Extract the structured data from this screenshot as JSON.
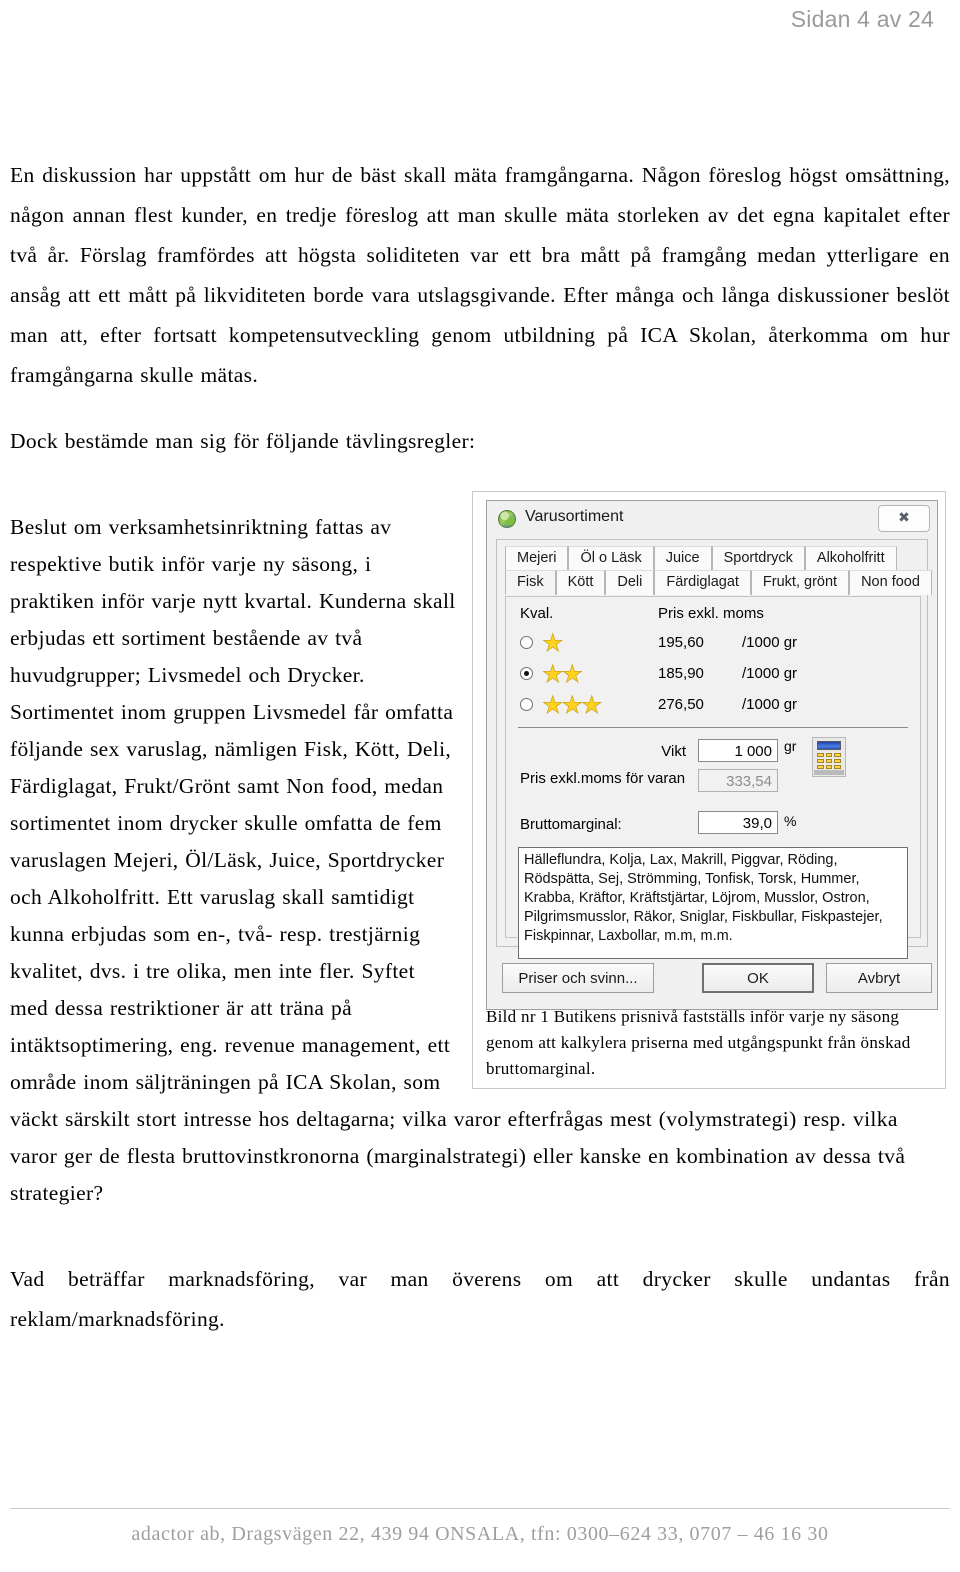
{
  "header": {
    "page_indicator": "Sidan 4 av 24"
  },
  "body": {
    "para1": "En diskussion har uppstått om hur de bäst skall mäta framgångarna. Någon föreslog högst omsättning, någon annan flest kunder, en tredje föreslog att man skulle mäta storleken av det egna kapitalet efter två år. Förslag framfördes att högsta soliditeten var ett bra mått på framgång medan ytterligare en ansåg att ett mått på likviditeten borde vara utslagsgivande. Efter många och långa diskussioner beslöt man att, efter fortsatt kompetensutveckling genom utbildning på ICA Skolan, återkomma om hur framgångarna skulle mätas.",
    "para2": "Dock bestämde man sig för följande tävlingsregler:",
    "para3": "Beslut om verksamhetsinriktning fattas av respektive butik inför varje ny säsong, i praktiken inför varje nytt kvartal. Kunderna skall erbjudas ett sortiment bestående av två huvudgrupper; Livsmedel och Drycker. Sortimentet inom gruppen Livsmedel får omfatta följande sex varuslag, nämligen Fisk, Kött, Deli, Färdiglagat, Frukt/Grönt samt Non food, medan sortimentet inom drycker skulle omfatta de fem varuslagen Mejeri, Öl/Läsk, Juice, Sportdrycker och Alkoholfritt. Ett varuslag skall samtidigt kunna erbjudas som en-, två- resp. trestjärnig kvalitet, dvs. i tre olika, men inte fler. Syftet med dessa restriktioner är att träna på intäktsoptimering, eng. revenue management, ett område inom säljträningen på ICA Skolan, som väckt särskilt stort intresse hos deltagarna; vilka varor efterfrågas mest (volymstrategi) resp. vilka varor ger de flesta bruttovinstkronorna (marginalstrategi) eller kanske en kombination av dessa två strategier?",
    "para4": "Vad beträffar marknadsföring, var man överens om att drycker skulle undantas från reklam/marknadsföring."
  },
  "figure": {
    "caption": "Bild nr 1  Butikens prisnivå fastställs inför varje ny säsong genom att kalkylera priserna med utgångspunkt från önskad bruttomarginal.",
    "dialog": {
      "title": "Varusortiment",
      "close_label": "✖",
      "tabs_row1": [
        "Mejeri",
        "Öl o Läsk",
        "Juice",
        "Sportdryck",
        "Alkoholfritt"
      ],
      "tabs_row2": [
        "Fisk",
        "Kött",
        "Deli",
        "Färdiglagat",
        "Frukt, grönt",
        "Non food"
      ],
      "active_tab": "Fisk",
      "quality_header": "Kval.",
      "price_header": "Pris exkl. moms",
      "quality_rows": [
        {
          "stars": "★",
          "selected": false,
          "price": "195,60",
          "unit": "/1000 gr"
        },
        {
          "stars": "★★",
          "selected": true,
          "price": "185,90",
          "unit": "/1000 gr"
        },
        {
          "stars": "★★★",
          "selected": false,
          "price": "276,50",
          "unit": "/1000 gr"
        }
      ],
      "fields": {
        "vikt_label": "Vikt",
        "vikt_value": "1 000",
        "vikt_unit": "gr",
        "pris_label": "Pris exkl.moms för varan",
        "pris_value": "333,54",
        "brutto_label": "Bruttomarginal:",
        "brutto_value": "39,0",
        "brutto_unit": "%"
      },
      "assortment_list": "Hälleflundra, Kolja, Lax, Makrill, Piggvar, Röding, Rödspätta, Sej, Strömming, Tonfisk, Torsk, Hummer, Krabba, Kräftor, Kräftstjärtar, Löjrom, Musslor, Ostron, Pilgrimsmusslor, Räkor, Sniglar, Fiskbullar, Fiskpastejer, Fiskpinnar, Laxbollar, m.m, m.m.",
      "buttons": {
        "priser": "Priser och svinn...",
        "ok": "OK",
        "avbryt": "Avbryt"
      }
    }
  },
  "footer": {
    "text": "adactor ab, Dragsvägen 22, 439 94 ONSALA, tfn: 0300–624 33, 0707 – 46 16 30"
  },
  "colors": {
    "star": "#ffd21e",
    "header_gray": "#9a9a9a",
    "footer_gray": "#9e9e9e"
  }
}
